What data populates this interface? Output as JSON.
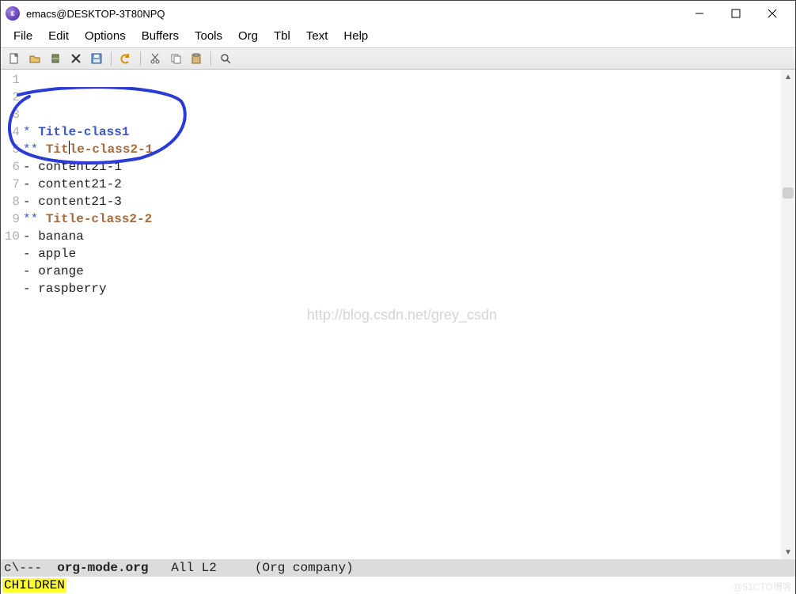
{
  "window": {
    "title": "emacs@DESKTOP-3T80NPQ"
  },
  "menubar": {
    "items": [
      "File",
      "Edit",
      "Options",
      "Buffers",
      "Tools",
      "Org",
      "Tbl",
      "Text",
      "Help"
    ]
  },
  "toolbar": {
    "icons": [
      "new-file",
      "open-folder",
      "kill-buffer",
      "close",
      "save",
      "sep",
      "undo",
      "sep",
      "cut",
      "copy",
      "paste",
      "sep",
      "search"
    ]
  },
  "buffer": {
    "lines": [
      {
        "num": "1",
        "class": "h1",
        "marker": "* ",
        "text": "Title-class1"
      },
      {
        "num": "2",
        "class": "h2",
        "marker": "** ",
        "text": "Title-class2-1",
        "cursor": true,
        "cursor_after": 3
      },
      {
        "num": "3",
        "class": "li",
        "marker": "- ",
        "text": "content21-1"
      },
      {
        "num": "4",
        "class": "li",
        "marker": "- ",
        "text": "content21-2"
      },
      {
        "num": "5",
        "class": "li",
        "marker": "- ",
        "text": "content21-3"
      },
      {
        "num": "6",
        "class": "h2",
        "marker": "** ",
        "text": "Title-class2-2"
      },
      {
        "num": "7",
        "class": "li",
        "marker": "- ",
        "text": "banana"
      },
      {
        "num": "8",
        "class": "li",
        "marker": "- ",
        "text": "apple"
      },
      {
        "num": "9",
        "class": "li",
        "marker": "- ",
        "text": "orange"
      },
      {
        "num": "10",
        "class": "li",
        "marker": "- ",
        "text": "raspberry"
      }
    ],
    "watermark": "http://blog.csdn.net/grey_csdn",
    "cornermark": "@51CTO博客"
  },
  "modeline": {
    "coding": "c",
    "modbits": "\\---  ",
    "buffer_name": "org-mode.org",
    "position": "All",
    "line": "L2",
    "modes": "(Org company)"
  },
  "echo": {
    "message": "CHILDREN"
  }
}
